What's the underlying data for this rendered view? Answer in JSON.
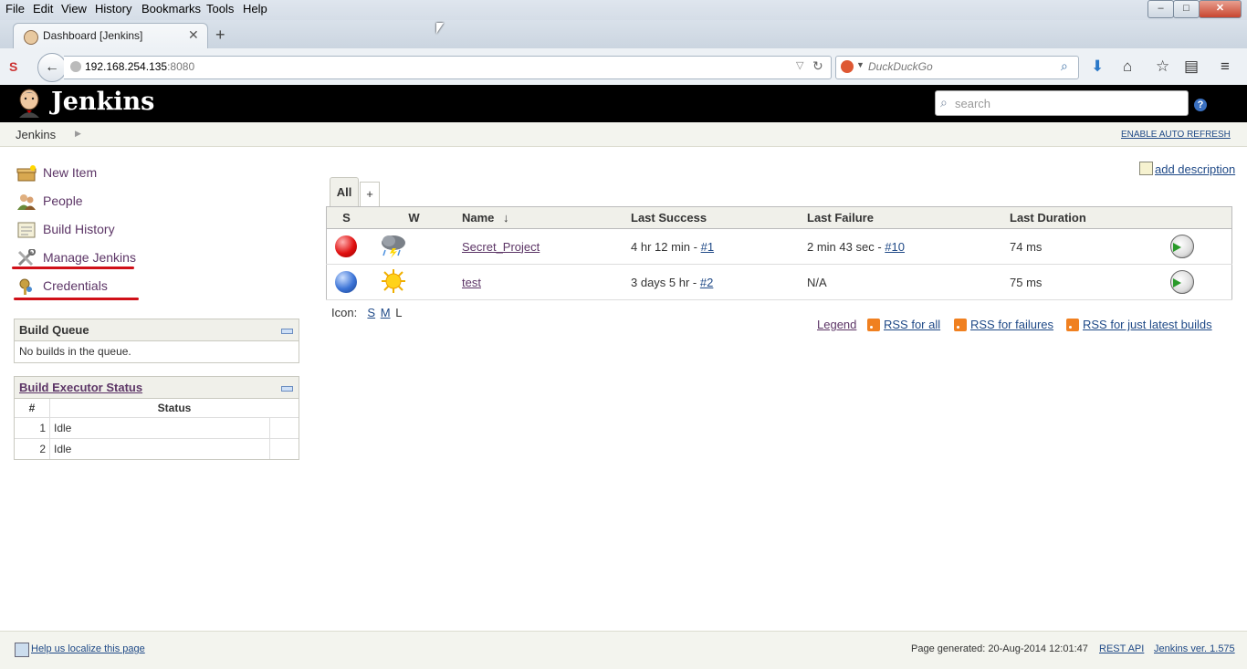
{
  "browser": {
    "menu": [
      "File",
      "Edit",
      "View",
      "History",
      "Bookmarks",
      "Tools",
      "Help"
    ],
    "tab_title": "Dashboard [Jenkins]",
    "url_host": "192.168.254.135",
    "url_port": ":8080",
    "search_placeholder": "DuckDuckGo",
    "window_controls": {
      "minimize": "–",
      "maximize": "□",
      "close": "✕"
    }
  },
  "jenkins": {
    "title": "Jenkins",
    "search_placeholder": "search",
    "help": "?",
    "breadcrumb": "Jenkins",
    "auto_refresh": "ENABLE AUTO REFRESH"
  },
  "side_tasks": [
    {
      "label": "New Item",
      "icon": "new-item-icon"
    },
    {
      "label": "People",
      "icon": "people-icon"
    },
    {
      "label": "Build History",
      "icon": "build-history-icon"
    },
    {
      "label": "Manage Jenkins",
      "icon": "manage-jenkins-icon"
    },
    {
      "label": "Credentials",
      "icon": "credentials-icon"
    }
  ],
  "build_queue": {
    "title": "Build Queue",
    "empty_text": "No builds in the queue."
  },
  "executors": {
    "title": "Build Executor Status",
    "col_num": "#",
    "col_status": "Status",
    "rows": [
      {
        "num": "1",
        "status": "Idle"
      },
      {
        "num": "2",
        "status": "Idle"
      }
    ]
  },
  "main": {
    "add_description": "add description",
    "view_tab": "All",
    "add_view": "+",
    "columns": {
      "s": "S",
      "w": "W",
      "name": "Name",
      "sort_arrow": "↓",
      "last_success": "Last Success",
      "last_failure": "Last Failure",
      "last_duration": "Last Duration"
    },
    "jobs": [
      {
        "status": "red",
        "weather": "storm",
        "name": "Secret_Project",
        "last_success": "4 hr 12 min - ",
        "last_success_build": "#1",
        "last_failure": "2 min 43 sec - ",
        "last_failure_build": "#10",
        "last_duration": "74 ms"
      },
      {
        "status": "blue",
        "weather": "sunny",
        "name": "test",
        "last_success": "3 days 5 hr - ",
        "last_success_build": "#2",
        "last_failure": "N/A",
        "last_failure_build": "",
        "last_duration": "75 ms"
      }
    ],
    "icon_label": "Icon:",
    "icon_sizes": [
      "S",
      "M",
      "L"
    ],
    "legend": "Legend",
    "rss_all": "RSS for all",
    "rss_failures": "RSS for failures",
    "rss_latest": "RSS for just latest builds"
  },
  "footer": {
    "localize": "Help us localize this page",
    "generated": "Page generated: 20-Aug-2014 12:01:47",
    "rest_api": "REST API",
    "version": "Jenkins ver. 1.575"
  }
}
